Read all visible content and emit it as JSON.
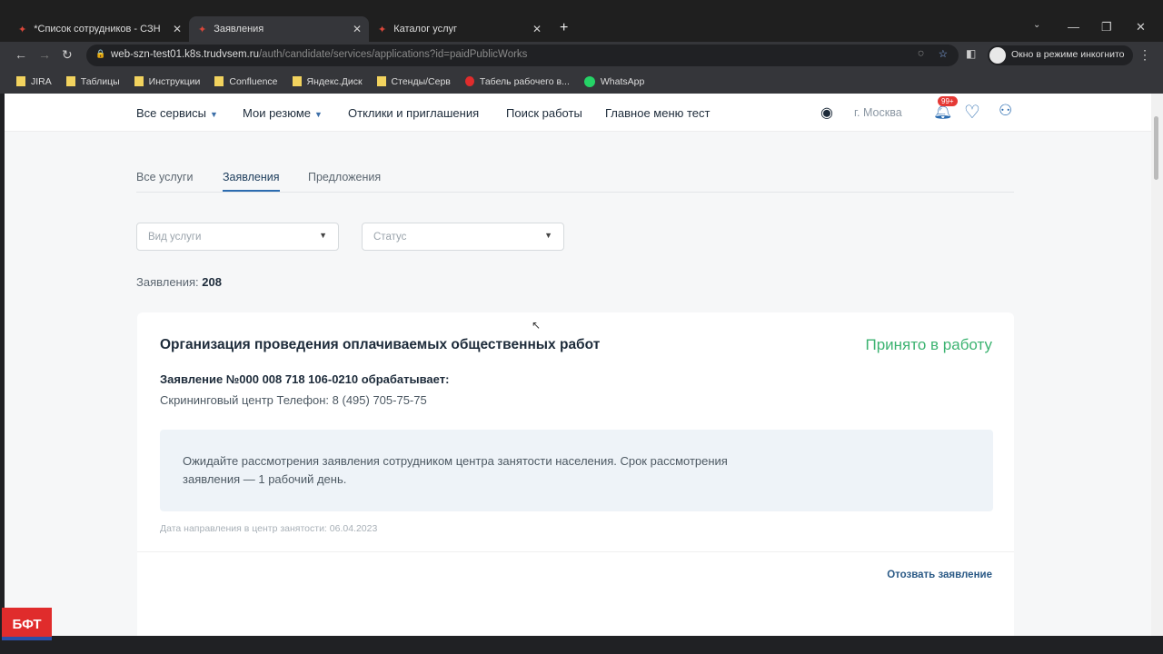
{
  "browser": {
    "tabs": [
      {
        "label": "*Список сотрудников - СЗН"
      },
      {
        "label": "Заявления"
      },
      {
        "label": "Каталог услуг"
      }
    ],
    "url_host": "web-szn-test01.k8s.trudvsem.ru",
    "url_path": "/auth/candidate/services/applications?id=paidPublicWorks",
    "incognito": "Окно в режиме инкогнито",
    "bookmarks": [
      "JIRA",
      "Таблицы",
      "Инструкции",
      "Confluence",
      "Яндекс.Диск",
      "Стенды/Серв",
      "Табель рабочего в...",
      "WhatsApp"
    ]
  },
  "header": {
    "menu": [
      "Все сервисы",
      "Мои резюме",
      "Отклики и приглашения",
      "Поиск работы",
      "Главное меню тест"
    ],
    "city": "г. Москва",
    "badge": "99+"
  },
  "tabs": [
    "Все услуги",
    "Заявления",
    "Предложения"
  ],
  "filters": {
    "service_placeholder": "Вид услуги",
    "status_placeholder": "Статус"
  },
  "count_label": "Заявления:",
  "count": "208",
  "card": {
    "title": "Организация проведения оплачиваемых общественных работ",
    "status": "Принято в работу",
    "application": "Заявление №000 008 718 106-0210 обрабатывает:",
    "center": "Скрининговый центр Телефон: 8 (495) 705-75-75",
    "info": "Ожидайте рассмотрения заявления сотрудником центра занятости населения. Срок рассмотрения заявления — 1 рабочий день.",
    "date": "Дата направления в центр занятости: 06.04.2023",
    "withdraw": "Отозвать заявление"
  },
  "logo": "БФТ"
}
